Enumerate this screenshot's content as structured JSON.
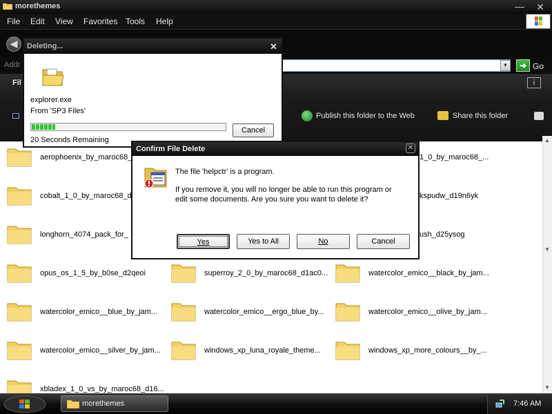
{
  "window": {
    "title": "morethemes",
    "menu": [
      "File",
      "Edit",
      "View",
      "Favorites",
      "Tools",
      "Help"
    ],
    "address_label": "Addr",
    "go_label": "Go"
  },
  "taskpane": {
    "section_label": "Fil",
    "publish_label": "Publish this folder to the Web",
    "share_label": "Share this folder"
  },
  "files": [
    "aerophoenix_by_maroc68_",
    "1_0_by_maroc68_...",
    "cobalt_1_0_by_maroc68_d",
    "kspudw_d19n6yk",
    "longhorn_4074_pack_for_",
    "ush_d25ysog",
    "opus_os_1_5_by_b0se_d2qeoi",
    "superroy_2_0_by_maroc68_d1ac0...",
    "watercolor_emico__black_by_jam...",
    "watercolor_emico__blue_by_jam...",
    "watercolor_emico__ergo_blue_by...",
    "watercolor_emico__olive_by_jam...",
    "watercolor_emico__silver_by_jam...",
    "windows_xp_luna_royale_theme...",
    "windows_xp_more_colours__by_...",
    "xbladex_1_0_vs_by_maroc68_d16..."
  ],
  "deleting_dialog": {
    "title": "Deleting...",
    "file": "explorer.exe",
    "from": "From 'SP3 Files'",
    "progress": 0.12,
    "remaining": "20 Seconds Remaining",
    "cancel": "Cancel"
  },
  "confirm_dialog": {
    "title": "Confirm File Delete",
    "line1": "The file 'helpctr' is a program.",
    "line2": "If you remove it, you will no longer be able to run this program or",
    "line3": "edit some documents. Are you sure you want to delete it?",
    "buttons": {
      "yes": "Yes",
      "yes_to_all": "Yes to All",
      "no": "No",
      "cancel": "Cancel"
    }
  },
  "taskbar": {
    "task_label": "morethemes",
    "clock": "7:46 AM"
  },
  "colors": {
    "chrome_dark": "#0a0a0a",
    "folder_yellow": "#f2d062",
    "progress_green": "#31c331"
  }
}
